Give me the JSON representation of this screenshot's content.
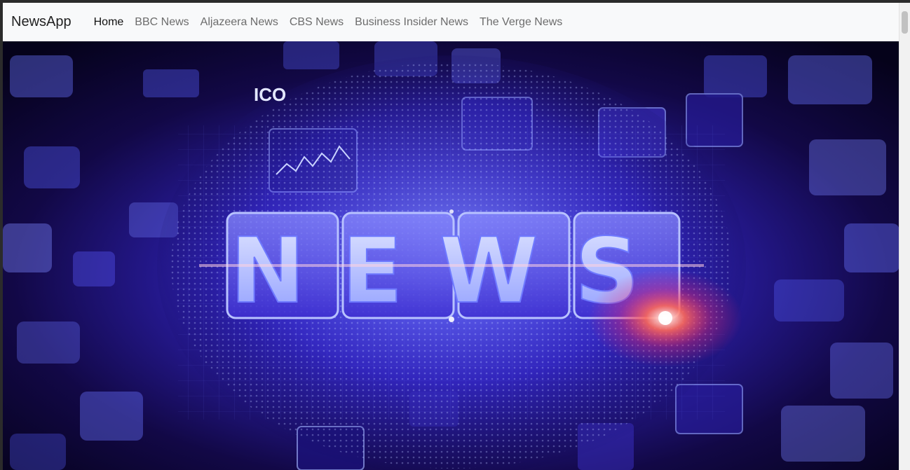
{
  "navbar": {
    "brand": "NewsApp",
    "links": [
      {
        "label": "Home",
        "active": true
      },
      {
        "label": "BBC News",
        "active": false
      },
      {
        "label": "Aljazeera News",
        "active": false
      },
      {
        "label": "CBS News",
        "active": false
      },
      {
        "label": "Business Insider News",
        "active": false
      },
      {
        "label": "The Verge News",
        "active": false
      }
    ]
  },
  "hero": {
    "headline": "NEWS",
    "tile_label": "ICO",
    "colors": {
      "primary": "#4a3cff",
      "glow": "#a9b7ff",
      "flare": "#ff3a2a",
      "dark": "#0a0530"
    }
  }
}
